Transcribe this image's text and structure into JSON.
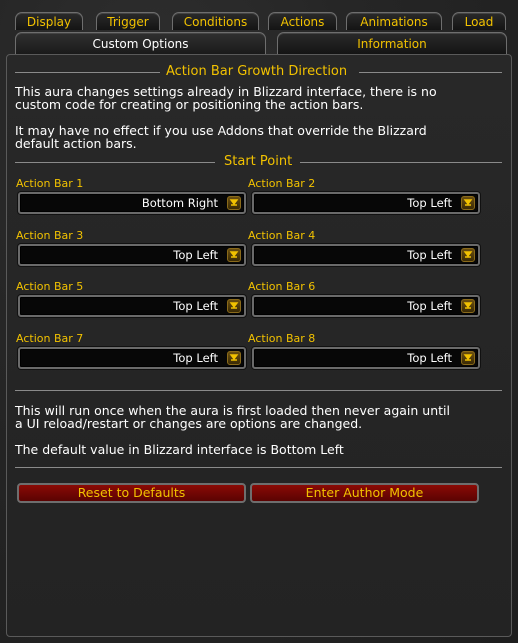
{
  "tabs_row1": [
    {
      "label": "Display"
    },
    {
      "label": "Trigger"
    },
    {
      "label": "Conditions"
    },
    {
      "label": "Actions"
    },
    {
      "label": "Animations"
    },
    {
      "label": "Load"
    }
  ],
  "tabs_row2": [
    {
      "label": "Custom Options",
      "selected": true
    },
    {
      "label": "Information",
      "selected": false
    }
  ],
  "section1": {
    "header": "Action Bar Growth Direction",
    "para1": [
      "This aura changes settings already in Blizzard interface, there is no",
      "custom code for creating or positioning the action bars."
    ],
    "para2": [
      "It may have no effect if you use Addons that override the Blizzard",
      "default action bars."
    ]
  },
  "section2": {
    "header": "Start Point",
    "dropdowns": [
      {
        "label": "Action Bar 1",
        "value": "Bottom Right"
      },
      {
        "label": "Action Bar 2",
        "value": "Top Left"
      },
      {
        "label": "Action Bar 3",
        "value": "Top Left"
      },
      {
        "label": "Action Bar 4",
        "value": "Top Left"
      },
      {
        "label": "Action Bar 5",
        "value": "Top Left"
      },
      {
        "label": "Action Bar 6",
        "value": "Top Left"
      },
      {
        "label": "Action Bar 7",
        "value": "Top Left"
      },
      {
        "label": "Action Bar 8",
        "value": "Top Left"
      }
    ]
  },
  "notes": {
    "para1": [
      "This will run once when the aura is first loaded then never again until",
      "a UI reload/restart or changes are options are changed."
    ],
    "para2": "The default value in Blizzard interface is Bottom Left"
  },
  "buttons": {
    "reset": "Reset to Defaults",
    "author": "Enter Author Mode"
  },
  "colors": {
    "accent_gold": "#f2c200",
    "button_red": "#8a0a05"
  }
}
